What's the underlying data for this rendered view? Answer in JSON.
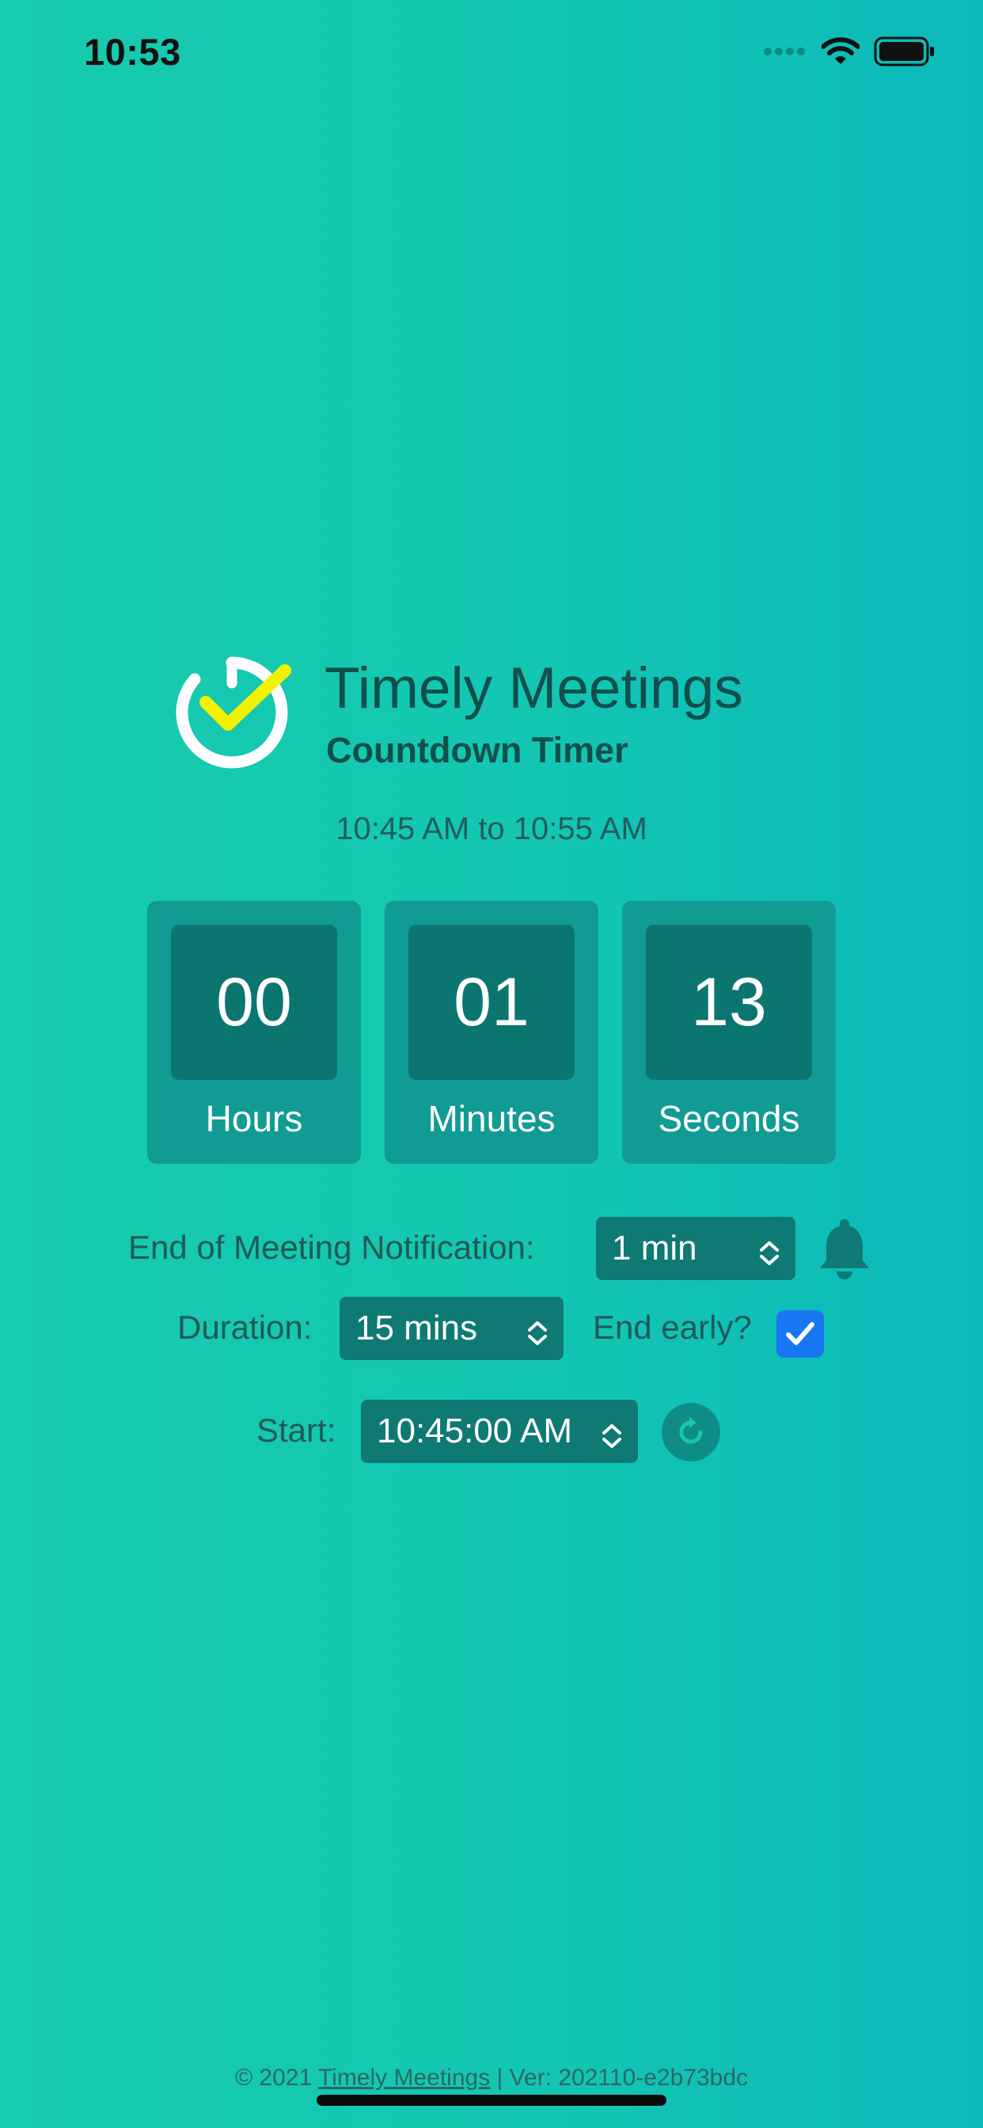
{
  "status_bar": {
    "time": "10:53",
    "signal_icon": "signal-dots-icon",
    "wifi_icon": "wifi-icon",
    "battery_icon": "battery-icon"
  },
  "header": {
    "logo_icon": "timer-check-logo-icon",
    "title": "Timely Meetings",
    "subtitle": "Countdown Timer",
    "time_range": "10:45 AM to 10:55 AM"
  },
  "countdown": {
    "hours_value": "00",
    "hours_label": "Hours",
    "minutes_value": "01",
    "minutes_label": "Minutes",
    "seconds_value": "13",
    "seconds_label": "Seconds"
  },
  "settings": {
    "notification_label": "End of Meeting Notification:",
    "notification_value": "1 min",
    "bell_icon": "bell-icon",
    "duration_label": "Duration:",
    "duration_value": "15 mins",
    "end_early_label": "End early?",
    "end_early_checked": true,
    "start_label": "Start:",
    "start_value": "10:45:00 AM",
    "refresh_icon": "refresh-icon"
  },
  "footer": {
    "copyright": "© 2021 ",
    "link_text": "Timely Meetings",
    "version": " | Ver: 202110-e2b73bdc"
  },
  "colors": {
    "background_start": "#17cbae",
    "background_end": "#0bb9bb",
    "box_outer": "#109b94",
    "box_inner": "#0b7670",
    "select_bg": "#0e7a73",
    "checkbox_blue": "#1877f2",
    "logo_check_yellow": "#f2f200"
  }
}
